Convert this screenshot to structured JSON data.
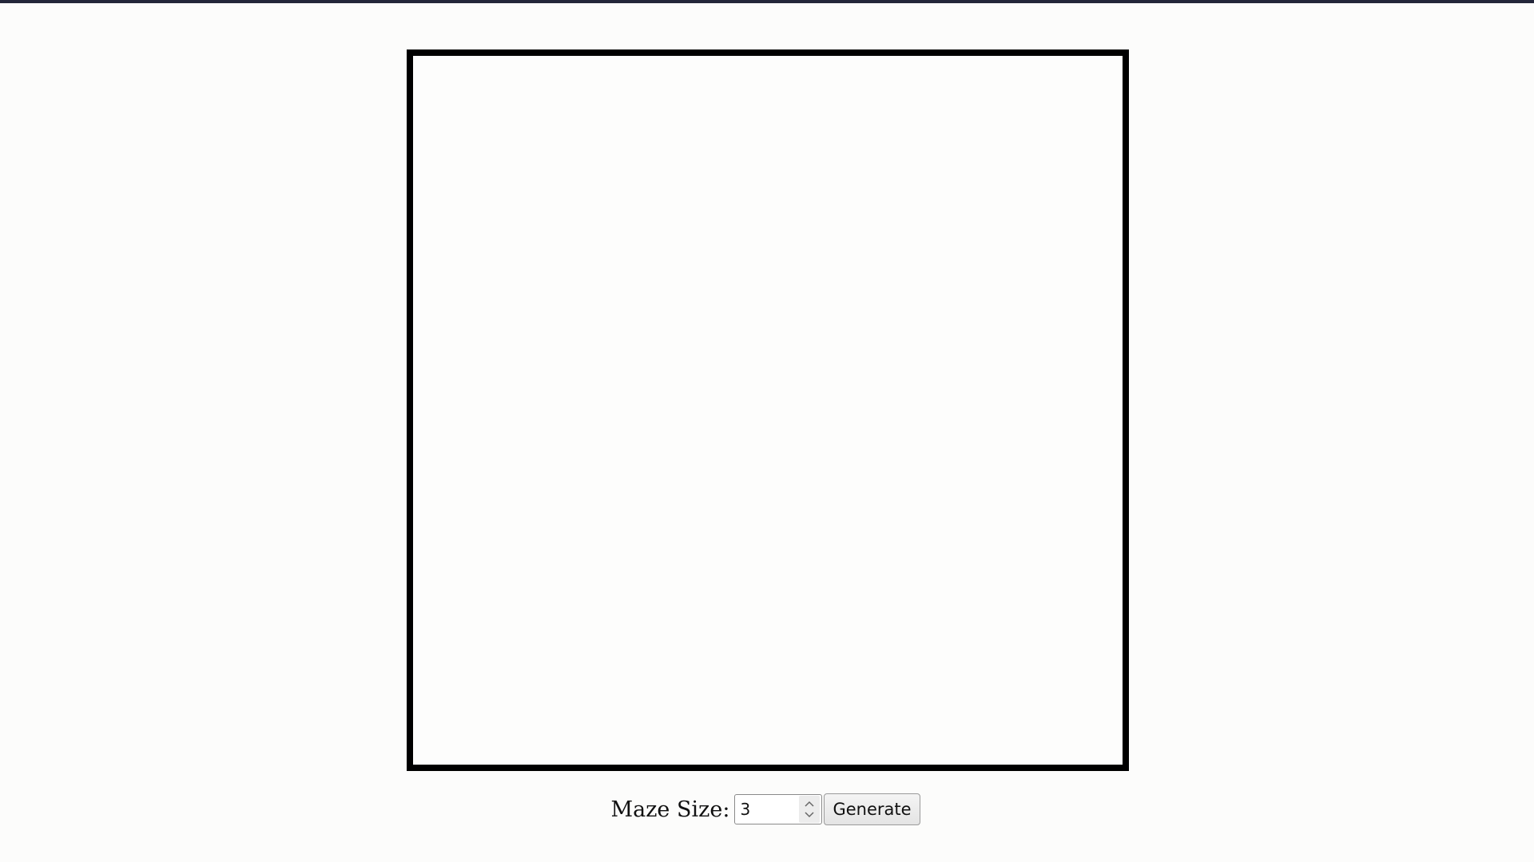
{
  "controls": {
    "size_label": "Maze Size:",
    "size_value": "3",
    "generate_label": "Generate"
  },
  "icons": {
    "spinner_up": "chevron-up-icon",
    "spinner_down": "chevron-down-icon"
  },
  "colors": {
    "background": "#fcfcfb",
    "top_strip": "#23263a",
    "maze_border": "#000000"
  }
}
